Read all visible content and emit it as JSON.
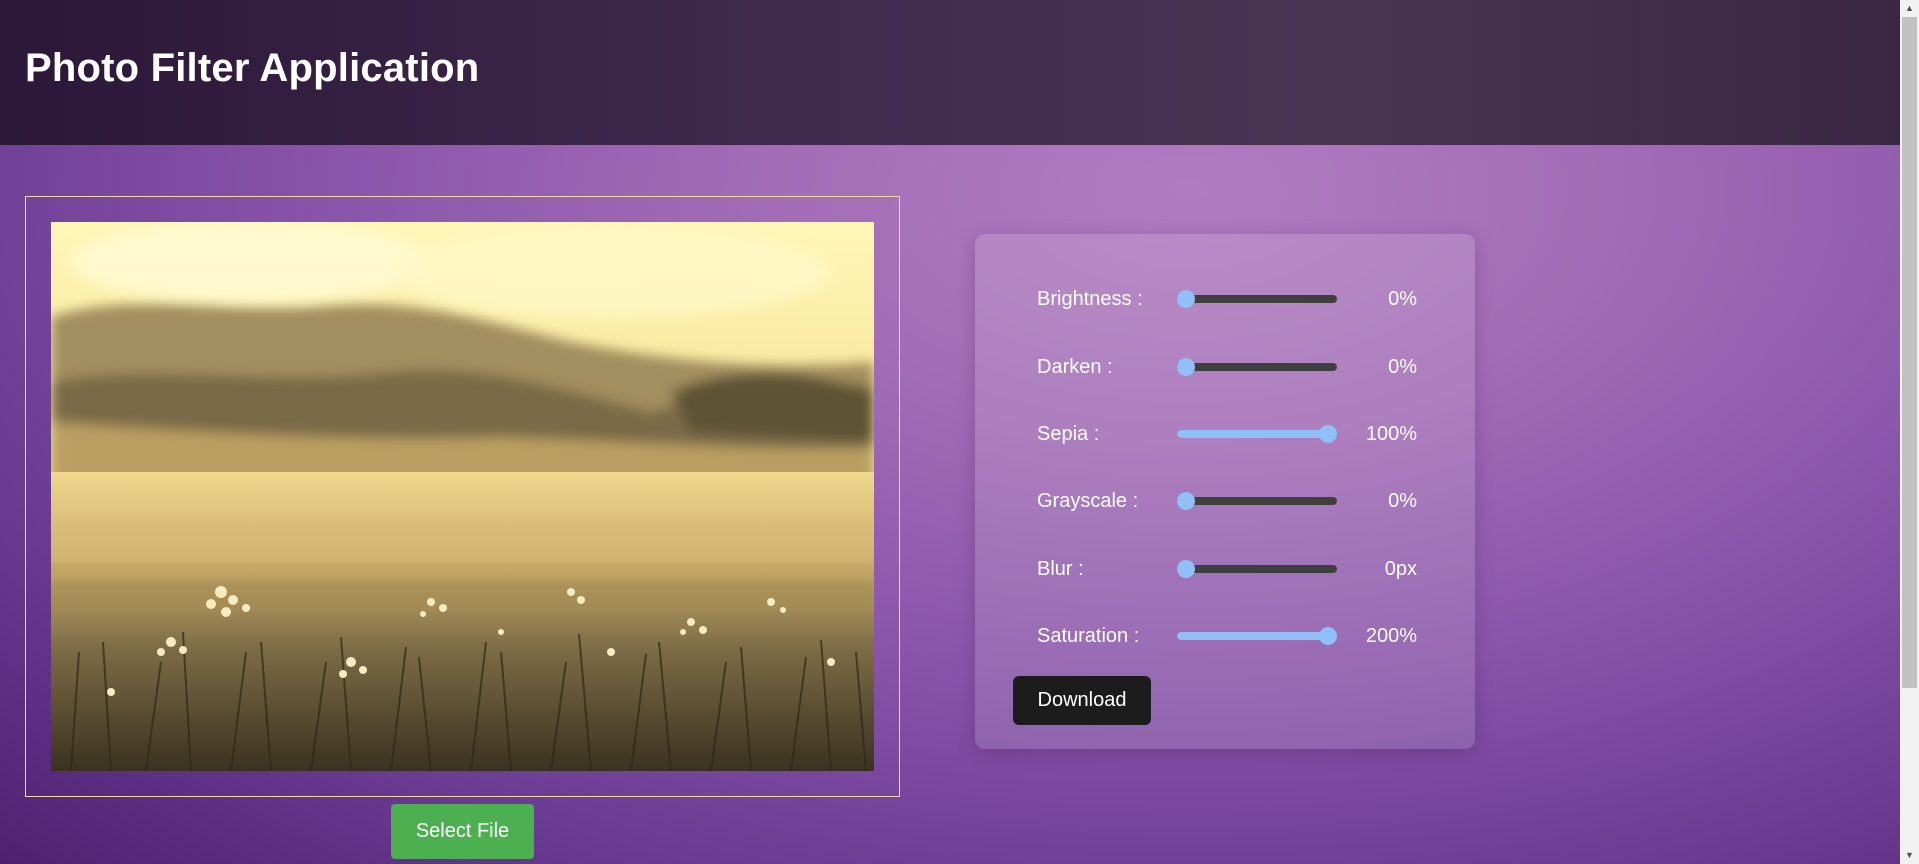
{
  "header": {
    "title": "Photo Filter Application"
  },
  "preview": {
    "image": "sepia-toned-meadow-with-flowers-and-mountains"
  },
  "select_file": {
    "label": "Select File"
  },
  "filters": [
    {
      "id": "brightness",
      "label": "Brightness :",
      "value_text": "0%",
      "level": 0.0
    },
    {
      "id": "darken",
      "label": "Darken :",
      "value_text": "0%",
      "level": 0.0
    },
    {
      "id": "sepia",
      "label": "Sepia :",
      "value_text": "100%",
      "level": 1.0
    },
    {
      "id": "grayscale",
      "label": "Grayscale :",
      "value_text": "0%",
      "level": 0.0
    },
    {
      "id": "blur",
      "label": "Blur :",
      "value_text": "0px",
      "level": 0.0
    },
    {
      "id": "saturation",
      "label": "Saturation :",
      "value_text": "200%",
      "level": 1.0
    }
  ],
  "download": {
    "label": "Download"
  },
  "colors": {
    "accent_slider": "#90c0f5",
    "select_button": "#4caf50",
    "download_button": "#1c1c1c"
  }
}
